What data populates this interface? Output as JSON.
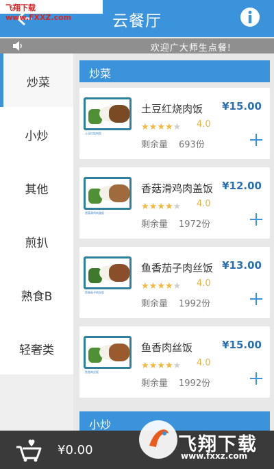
{
  "header": {
    "title": "云餐厅"
  },
  "watermark": {
    "text": "飞翔下载 www.FXXZ.com"
  },
  "notice": {
    "text": "欢迎广大师生点餐!"
  },
  "sidebar": {
    "items": [
      {
        "label": "炒菜"
      },
      {
        "label": "小炒"
      },
      {
        "label": "其他"
      },
      {
        "label": "煎扒"
      },
      {
        "label": "熟食B"
      },
      {
        "label": "轻奢类"
      }
    ]
  },
  "sections": [
    {
      "title": "炒菜"
    },
    {
      "title": "小炒"
    }
  ],
  "items": [
    {
      "name": "土豆红烧肉饭",
      "price": "¥15.00",
      "rating": "4.0",
      "stars": 4,
      "stock_label": "剩余量",
      "stock": "693份",
      "caption": "土豆红烧肉饭"
    },
    {
      "name": "香菇滑鸡肉盖饭",
      "price": "¥12.00",
      "rating": "4.0",
      "stars": 4,
      "stock_label": "剩余量",
      "stock": "1972份",
      "caption": "香菇滑鸡肉盖饭"
    },
    {
      "name": "鱼香茄子肉丝饭",
      "price": "¥13.00",
      "rating": "4.0",
      "stars": 4,
      "stock_label": "剩余量",
      "stock": "1992份",
      "caption": "鱼香茄子肉丝饭"
    },
    {
      "name": "鱼香肉丝饭",
      "price": "¥15.00",
      "rating": "4.0",
      "stars": 4,
      "stock_label": "剩余量",
      "stock": "1992份",
      "caption": "鱼香肉丝饭"
    }
  ],
  "cart": {
    "total": "¥0.00"
  },
  "logo_watermark": {
    "text": "飞翔下载",
    "sub": "www.fxxz.com"
  },
  "colors": {
    "primary": "#3b93dc",
    "price": "#2c6fb0",
    "star": "#f3b83e",
    "cartbar": "#3a3a3a"
  },
  "icons": {
    "back": "back-arrow-icon",
    "info": "info-icon",
    "speaker": "speaker-icon",
    "plus": "plus-icon",
    "cart": "cart-heart-icon"
  }
}
